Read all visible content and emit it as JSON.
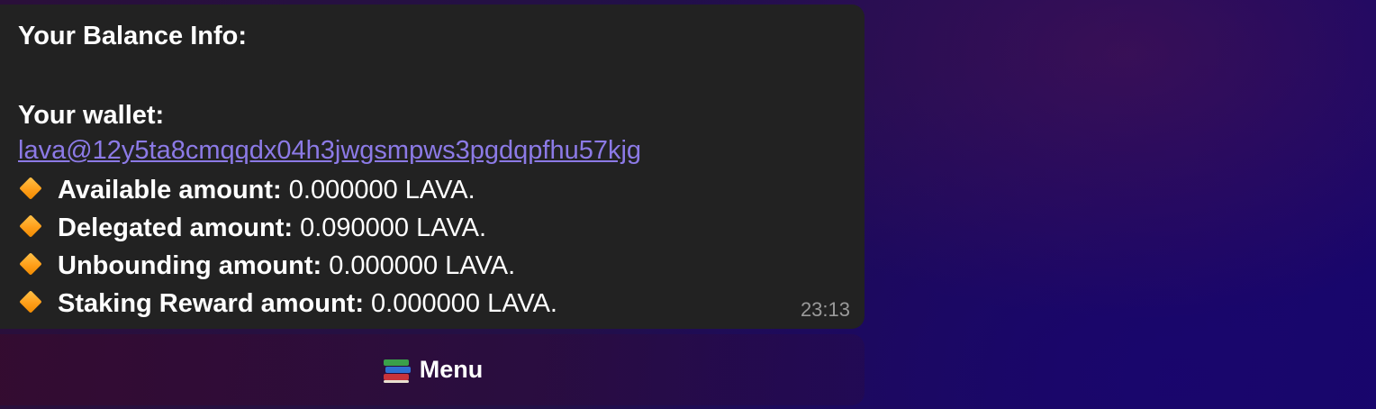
{
  "message": {
    "title": "Your Balance Info:",
    "wallet_label": "Your wallet:",
    "wallet_address": "lava@12y5ta8cmqqdx04h3jwgsmpws3pgdqpfhu57kjg",
    "items": [
      {
        "icon": "orange-diamond-icon",
        "label": "Available amount:",
        "value": " 0.000000 LAVA."
      },
      {
        "icon": "orange-diamond-icon",
        "label": "Delegated amount:",
        "value": " 0.090000 LAVA."
      },
      {
        "icon": "orange-diamond-icon",
        "label": "Unbounding amount:",
        "value": " 0.000000 LAVA."
      },
      {
        "icon": "orange-diamond-icon",
        "label": "Staking Reward amount:",
        "value": " 0.000000 LAVA."
      }
    ],
    "time": "23:13"
  },
  "keyboard": {
    "menu_icon": "books-icon",
    "menu_label": "Menu"
  },
  "colors": {
    "bubble": "#222222",
    "link": "#8c7ae6",
    "accent_diamond": "#ff9f1a",
    "timestamp": "#9a9a9a"
  }
}
